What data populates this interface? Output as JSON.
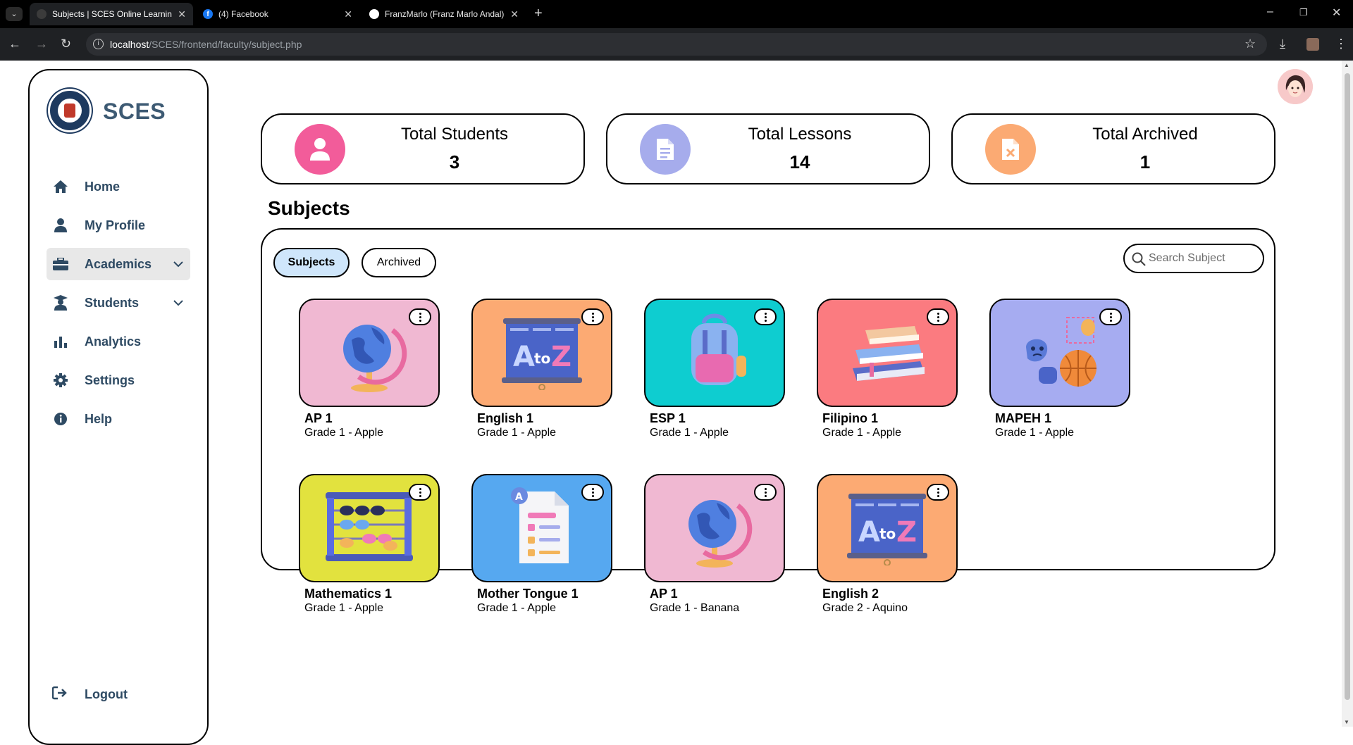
{
  "browser": {
    "tabs": [
      {
        "title": "Subjects | SCES Online Learning",
        "active": true
      },
      {
        "title": "(4) Facebook",
        "active": false
      },
      {
        "title": "FranzMarlo (Franz Marlo Andal)",
        "active": false
      }
    ],
    "url_host": "localhost",
    "url_path": "/SCES/frontend/faculty/subject.php"
  },
  "sidebar": {
    "brand": "SCES",
    "items": [
      {
        "label": "Home",
        "icon": "home-icon"
      },
      {
        "label": "My Profile",
        "icon": "user-icon"
      },
      {
        "label": "Academics",
        "icon": "briefcase-icon",
        "active": true,
        "dropdown": true
      },
      {
        "label": "Students",
        "icon": "graduate-icon",
        "dropdown": true
      },
      {
        "label": "Analytics",
        "icon": "bar-chart-icon"
      },
      {
        "label": "Settings",
        "icon": "gear-icon"
      },
      {
        "label": "Help",
        "icon": "info-icon"
      }
    ],
    "logout": "Logout"
  },
  "stats": [
    {
      "label": "Total Students",
      "value": "3",
      "color": "#f25c9a",
      "icon": "user-icon"
    },
    {
      "label": "Total Lessons",
      "value": "14",
      "color": "#a6acec",
      "icon": "document-icon"
    },
    {
      "label": "Total Archived",
      "value": "1",
      "color": "#fbaa73",
      "icon": "archive-file-icon"
    }
  ],
  "main": {
    "title": "Subjects",
    "tabs": {
      "subjects": "Subjects",
      "archived": "Archived"
    },
    "search_placeholder": "Search Subject"
  },
  "subjects": [
    {
      "name": "AP 1",
      "detail": "Grade 1 - Apple",
      "bg": "#f0b8d2",
      "art": "globe"
    },
    {
      "name": "English 1",
      "detail": "Grade 1 - Apple",
      "bg": "#fcaa73",
      "art": "atoz"
    },
    {
      "name": "ESP 1",
      "detail": "Grade 1 - Apple",
      "bg": "#0ecdd0",
      "art": "backpack"
    },
    {
      "name": "Filipino 1",
      "detail": "Grade 1 - Apple",
      "bg": "#fb7b80",
      "art": "books"
    },
    {
      "name": "MAPEH 1",
      "detail": "Grade 1 - Apple",
      "bg": "#a6acf1",
      "art": "arts"
    },
    {
      "name": "Mathematics 1",
      "detail": "Grade 1 - Apple",
      "bg": "#e2e23e",
      "art": "abacus"
    },
    {
      "name": "Mother Tongue 1",
      "detail": "Grade 1 - Apple",
      "bg": "#56a8f0",
      "art": "paper"
    },
    {
      "name": "AP 1",
      "detail": "Grade 1 - Banana",
      "bg": "#f0b8d2",
      "art": "globe"
    },
    {
      "name": "English 2",
      "detail": "Grade 2 - Aquino",
      "bg": "#fcaa73",
      "art": "atoz"
    }
  ]
}
